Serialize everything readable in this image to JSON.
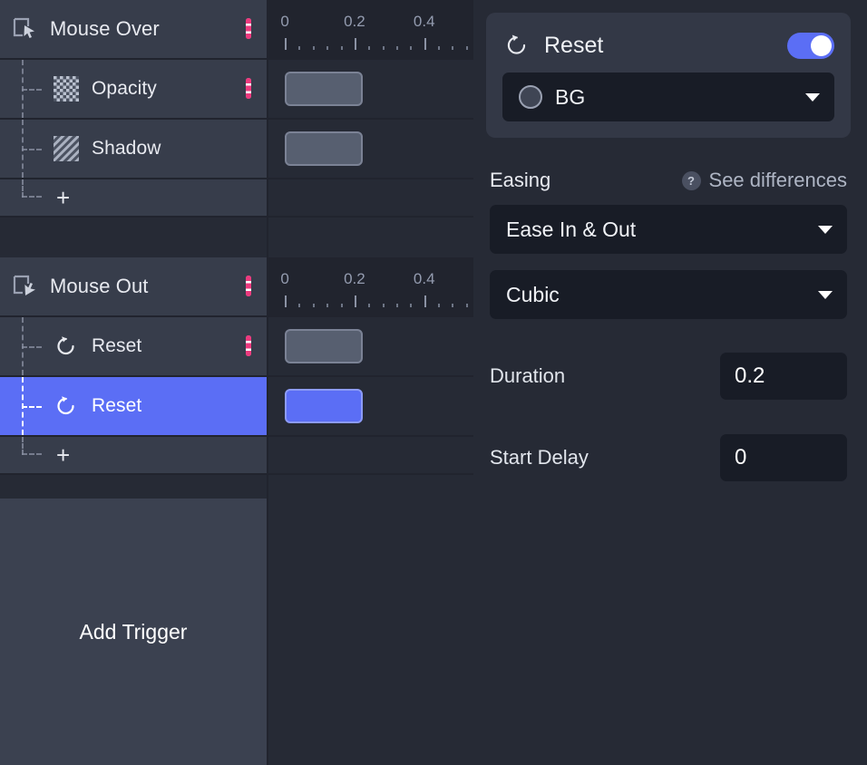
{
  "timeline": {
    "ruler": {
      "labels": [
        "0",
        "0.2",
        "0.4"
      ],
      "label_positions_pct": [
        8,
        42,
        76
      ],
      "major_tick_count": 6,
      "minor_per_major": 4
    },
    "groups": [
      {
        "trigger": {
          "name": "trigger-row",
          "icon": "mouse-over-icon",
          "title": "Mouse Over",
          "badge": "square-dashed"
        },
        "children": [
          {
            "icon": "opacity-checkerboard-icon",
            "title": "Opacity",
            "badge": "pill-dashed",
            "bar": {
              "left_pct": 8,
              "width_pct": 38,
              "selected": false
            }
          },
          {
            "icon": "shadow-stripes-icon",
            "title": "Shadow",
            "badge": "circle-white",
            "bar": {
              "left_pct": 8,
              "width_pct": 38,
              "selected": false
            }
          }
        ],
        "add_label": "+"
      },
      {
        "trigger": {
          "name": "trigger-row",
          "icon": "mouse-out-icon",
          "title": "Mouse Out",
          "badge": "square-dashed"
        },
        "children": [
          {
            "icon": "reset-icon",
            "title": "Reset",
            "badge": "pill-dashed",
            "bar": {
              "left_pct": 8,
              "width_pct": 38,
              "selected": false
            }
          },
          {
            "icon": "reset-icon",
            "title": "Reset",
            "badge": "circle-white",
            "bar": {
              "left_pct": 8,
              "width_pct": 38,
              "selected": true
            }
          }
        ],
        "add_label": "+"
      }
    ],
    "add_trigger_label": "Add Trigger"
  },
  "inspector": {
    "action_card": {
      "icon": "reset-icon",
      "title": "Reset",
      "enabled": true,
      "target_select": {
        "value": "BG",
        "swatch": "circle-shape-icon",
        "caret": "chevron-down-icon"
      }
    },
    "easing": {
      "section_title": "Easing",
      "help_icon": "question-mark-icon",
      "help_label": "See differences",
      "type_value": "Ease In & Out",
      "curve_value": "Cubic"
    },
    "duration": {
      "label": "Duration",
      "value": "0.2"
    },
    "start_delay": {
      "label": "Start Delay",
      "value": "0"
    }
  },
  "colors": {
    "accent_blue": "#5b6ef5",
    "badge_pink": "#ec3a7e",
    "panel_bg": "#262a35",
    "row_bg": "#373d4b",
    "input_bg": "#181c26"
  }
}
